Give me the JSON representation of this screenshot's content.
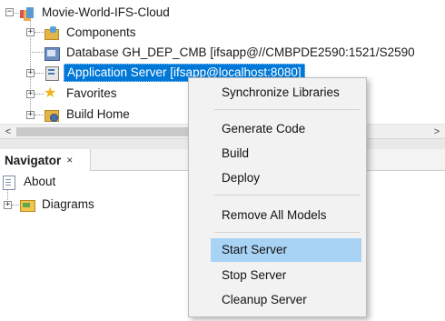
{
  "project_tree": {
    "root": {
      "label": "Movie-World-IFS-Cloud",
      "icon": "project-icon"
    },
    "items": [
      {
        "label": "Components",
        "icon": "components-folder-icon"
      },
      {
        "label": "Database GH_DEP_CMB [ifsapp@//CMBPDE2590:1521/S2590",
        "icon": "database-icon"
      },
      {
        "label": "Application Server [ifsapp@localhost:8080]",
        "icon": "application-server-icon",
        "selected": true
      },
      {
        "label": "Favorites",
        "icon": "star-icon"
      },
      {
        "label": "Build Home",
        "icon": "build-home-icon"
      }
    ],
    "scroll_left": "<",
    "scroll_right": ">"
  },
  "navigator": {
    "tab_label": "Navigator",
    "close_glyph": "×",
    "items": [
      {
        "label": "About",
        "icon": "document-icon"
      },
      {
        "label": "Diagrams",
        "icon": "diagrams-folder-icon"
      }
    ]
  },
  "context_menu": {
    "items": [
      {
        "label": "Synchronize Libraries"
      },
      {
        "label": "Generate Code"
      },
      {
        "label": "Build"
      },
      {
        "label": "Deploy"
      },
      {
        "label": "Remove All Models"
      },
      {
        "label": "Start Server",
        "highlighted": true
      },
      {
        "label": "Stop Server"
      },
      {
        "label": "Cleanup Server"
      }
    ]
  },
  "colors": {
    "selection": "#0078d7",
    "menu_highlight": "#a9d3f5",
    "menu_background": "#f2f2f2"
  }
}
